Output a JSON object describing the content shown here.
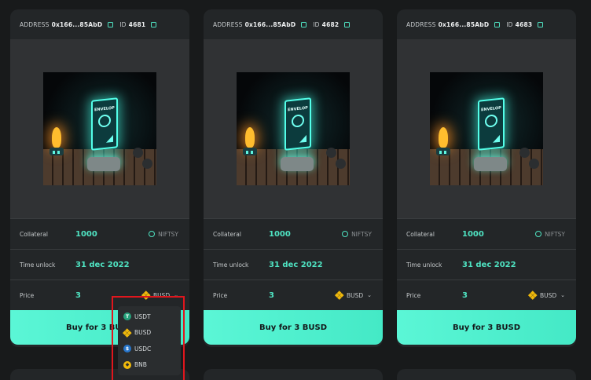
{
  "cards": [
    {
      "address_label": "ADDRESS",
      "address": "0x166...85AbD",
      "id_label": "ID",
      "id": "4681",
      "collateral_label": "Collateral",
      "collateral": "1000",
      "collateral_token": "NIFTSY",
      "time_label": "Time unlock",
      "time": "31 dec 2022",
      "price_label": "Price",
      "price": "3",
      "price_token": "BUSD",
      "buy_label": "Buy for 3 BUSD"
    },
    {
      "address_label": "ADDRESS",
      "address": "0x166...85AbD",
      "id_label": "ID",
      "id": "4682",
      "collateral_label": "Collateral",
      "collateral": "1000",
      "collateral_token": "NIFTSY",
      "time_label": "Time unlock",
      "time": "31 dec 2022",
      "price_label": "Price",
      "price": "3",
      "price_token": "BUSD",
      "buy_label": "Buy for 3 BUSD"
    },
    {
      "address_label": "ADDRESS",
      "address": "0x166...85AbD",
      "id_label": "ID",
      "id": "4683",
      "collateral_label": "Collateral",
      "collateral": "1000",
      "collateral_token": "NIFTSY",
      "time_label": "Time unlock",
      "time": "31 dec 2022",
      "price_label": "Price",
      "price": "3",
      "price_token": "BUSD",
      "buy_label": "Buy for 3 BUSD"
    }
  ],
  "nft_art_text": "ENVELOP",
  "dropdown": {
    "options": [
      "USDT",
      "BUSD",
      "USDC",
      "BNB"
    ]
  },
  "colors": {
    "accent": "#4fe3c2",
    "button": "#4ff0cf",
    "highlight": "#e0161d"
  }
}
